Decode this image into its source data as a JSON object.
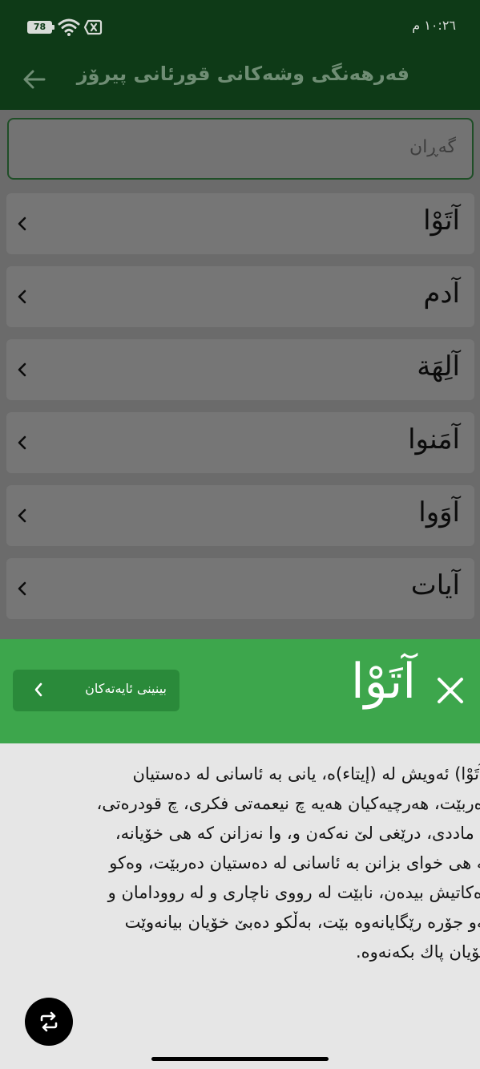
{
  "status_bar": {
    "battery": "78",
    "time": "١٠:٢٦ م"
  },
  "app_bar": {
    "title": "فەرهەنگی وشەکانی قورئانی پیرۆز",
    "back_icon": "arrow-left-icon"
  },
  "search": {
    "placeholder": "گەڕان"
  },
  "word_list": [
    {
      "word": "آتَوْا"
    },
    {
      "word": "آدم"
    },
    {
      "word": "آلِهَة"
    },
    {
      "word": "آمَنوا"
    },
    {
      "word": "آوَوا"
    },
    {
      "word": "آيات"
    }
  ],
  "detail_sheet": {
    "word": "آتَوْا",
    "close_icon": "close-icon",
    "verses_button_label": "بینینی ئایەتەکان",
    "explanation_lines": [
      "(آتَوْا) ئەویش لە (إيتاء)ە، یانی بە ئاسانی لە دەستیان",
      "دەربێت، هەرچیەکیان هەیە چ نیعمەتی فکری، چ قودرەتی،",
      "چ ماددی، درێغی لێ نەکەن و، وا نەزانن کە هی خۆیانە،",
      "بە هی خوای بزانن بە ئاسانی لە دەستیان دەربێت، وەکو",
      "زەکاتیش بیدەن، نابێت لە رووی ناچاری و لە روودامان و",
      "ئەو جۆرە رێگایانەوە بێت، بەڵکو دەبێ خۆیان بیانەوێت",
      "خۆیان پاك بکەنەوە."
    ]
  },
  "fab": {
    "icon": "repeat-icon"
  },
  "colors": {
    "primary_dark": "#0e3a17",
    "accent": "#3da64c",
    "accent_dark": "#2a8a3a",
    "scrim_gray": "#6b6b6b"
  }
}
